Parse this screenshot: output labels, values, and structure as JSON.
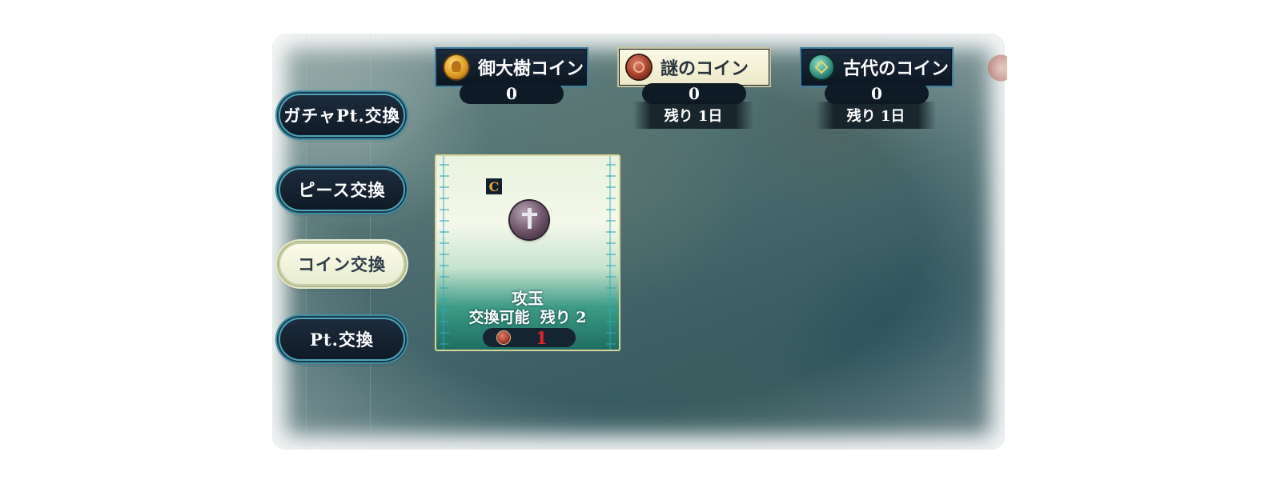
{
  "tabs": [
    {
      "label": "ガチャPt.交換",
      "active": false
    },
    {
      "label": "ピース交換",
      "active": false
    },
    {
      "label": "コイン交換",
      "active": true
    },
    {
      "label": "Pt.交換",
      "active": false
    }
  ],
  "coins": [
    {
      "name": "御大樹コイン",
      "icon": "gold-tree-coin-icon",
      "count": "0",
      "remaining": "",
      "active": false
    },
    {
      "name": "謎のコイン",
      "icon": "mystery-coin-icon",
      "count": "0",
      "remaining": "残り 1日",
      "active": true
    },
    {
      "name": "古代のコイン",
      "icon": "ancient-coin-icon",
      "count": "0",
      "remaining": "残り 1日",
      "active": false
    }
  ],
  "item": {
    "rarity": "C",
    "icon": "attack-orb-icon",
    "name": "攻玉",
    "limit": "交換可能  残り 2",
    "cost_icon": "mystery-coin-icon",
    "cost": "1"
  },
  "colors": {
    "tab_border": "#4aa3b8",
    "active_bg": "#fbfbe9",
    "cost_text": "#e0262a"
  }
}
